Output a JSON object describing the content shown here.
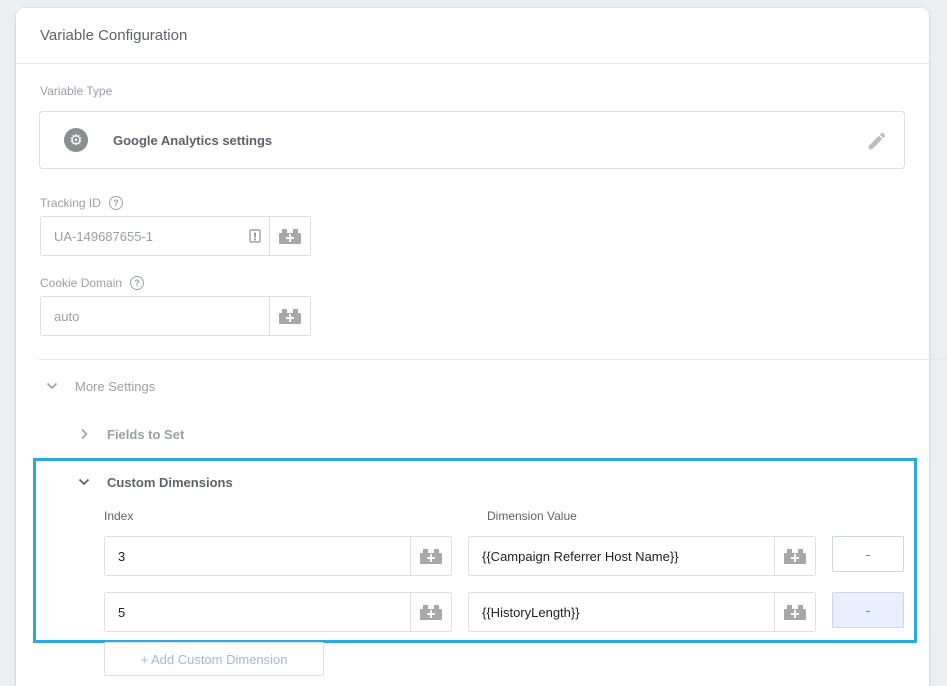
{
  "card": {
    "title": "Variable Configuration"
  },
  "variable_type": {
    "label": "Variable Type",
    "name": "Google Analytics settings",
    "icon": "gear-icon",
    "edit_icon": "pencil-icon"
  },
  "tracking_id": {
    "label": "Tracking ID",
    "value": "UA-149687655-1"
  },
  "cookie_domain": {
    "label": "Cookie Domain",
    "value": "auto"
  },
  "more_settings": {
    "label": "More Settings",
    "expanded": true
  },
  "fields_to_set": {
    "label": "Fields to Set",
    "expanded": false
  },
  "custom_dimensions": {
    "label": "Custom Dimensions",
    "expanded": true,
    "index_header": "Index",
    "value_header": "Dimension Value",
    "rows": [
      {
        "index": "3",
        "value": "{{Campaign Referrer Host Name}}",
        "remove_label": "-"
      },
      {
        "index": "5",
        "value": "{{HistoryLength}}",
        "remove_label": "-"
      }
    ],
    "add_label": "+ Add Custom Dimension"
  },
  "colors": {
    "highlight": "#29abe2",
    "accent": "#4285f4"
  }
}
